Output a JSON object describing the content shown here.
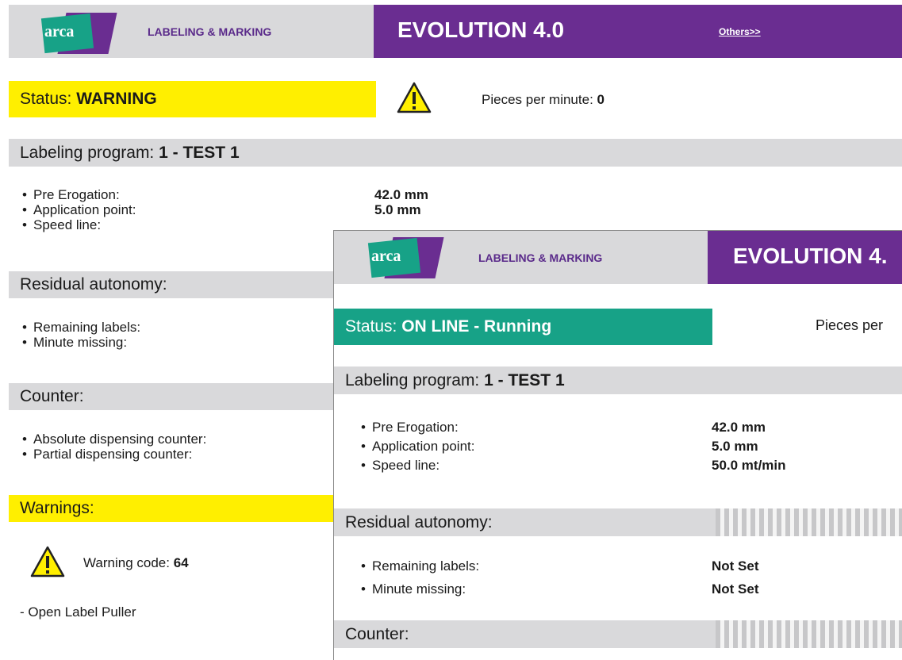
{
  "brand": {
    "logo_text": "arca",
    "tagline": "LABELING & MARKING"
  },
  "back": {
    "product": "EVOLUTION 4.0",
    "others_link": "Others>>",
    "status_label": "Status: ",
    "status_value": "WARNING",
    "ppm_label": "Pieces per minute: ",
    "ppm_value": "0",
    "program_label": "Labeling program: ",
    "program_value": "1 - TEST 1",
    "program_rows": [
      {
        "label": "Pre Erogation:",
        "value": "42.0 mm"
      },
      {
        "label": "Application point:",
        "value": "5.0 mm"
      },
      {
        "label": "Speed line:",
        "value": ""
      }
    ],
    "residual_title": "Residual autonomy:",
    "residual_rows": [
      "Remaining labels:",
      "Minute missing:"
    ],
    "counter_title": "Counter:",
    "counter_rows": [
      "Absolute dispensing counter:",
      "Partial dispensing counter:"
    ],
    "warnings_title": "Warnings:",
    "warning_code_label": "Warning code: ",
    "warning_code_value": "64",
    "warning_message": "- Open Label Puller"
  },
  "front": {
    "product": "EVOLUTION 4.",
    "status_label": "Status: ",
    "status_value": "ON LINE - Running",
    "ppm_label": "Pieces per",
    "program_label": "Labeling program: ",
    "program_value": "1 - TEST 1",
    "program_rows": [
      {
        "label": "Pre Erogation:",
        "value": "42.0 mm"
      },
      {
        "label": "Application point:",
        "value": "5.0 mm"
      },
      {
        "label": "Speed line:",
        "value": "50.0 mt/min"
      }
    ],
    "residual_title": "Residual autonomy:",
    "residual_rows": [
      {
        "label": "Remaining labels:",
        "value": "Not Set"
      },
      {
        "label": "Minute missing:",
        "value": "Not Set"
      }
    ],
    "counter_title": "Counter:"
  },
  "colors": {
    "purple": "#6a2d91",
    "teal": "#17a287",
    "yellow": "#ffef00",
    "gray": "#d9d9db"
  }
}
